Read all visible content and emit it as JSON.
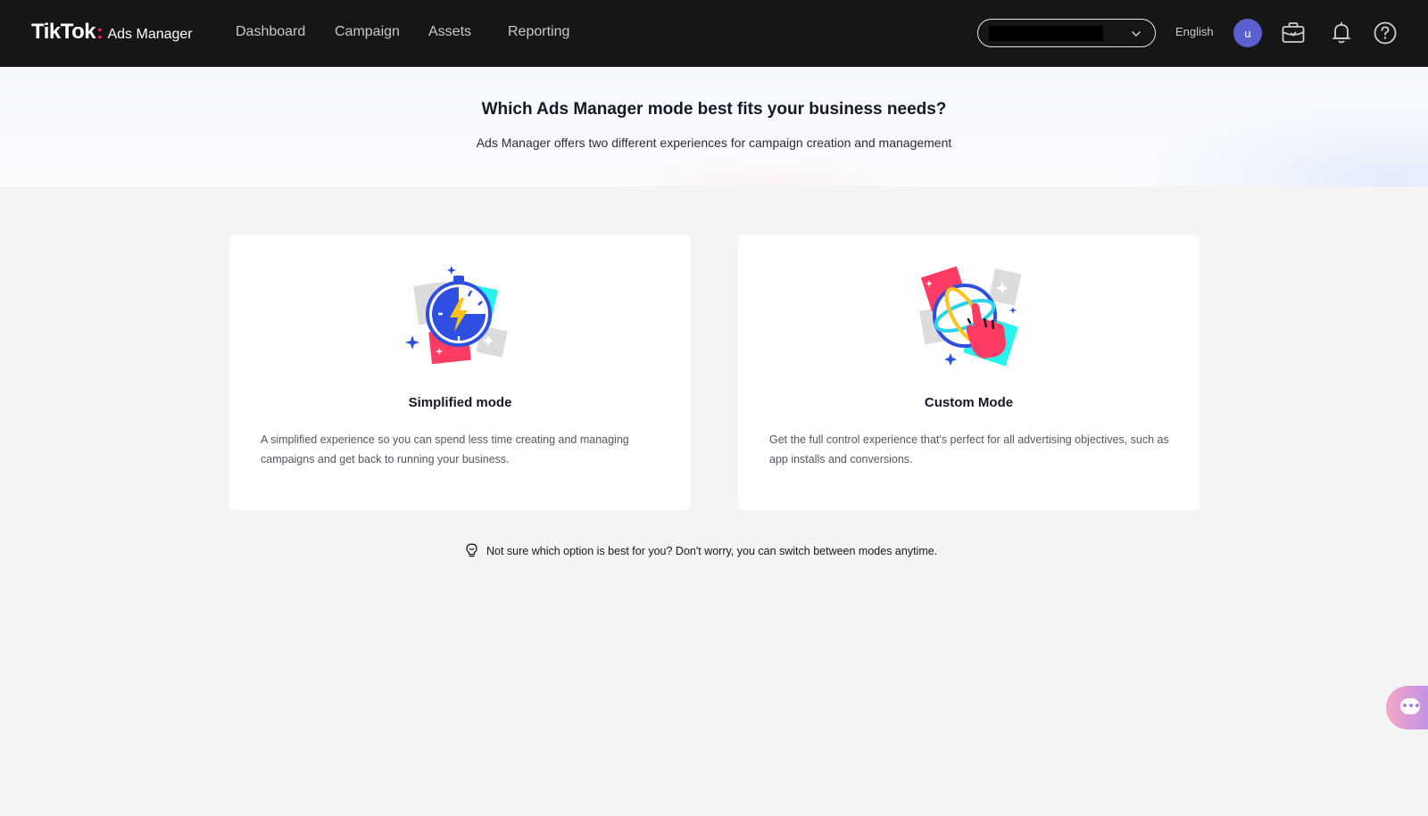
{
  "header": {
    "logo_brand": "TikTok",
    "logo_colon": ":",
    "logo_product": "Ads Manager",
    "nav": [
      {
        "label": "Dashboard"
      },
      {
        "label": "Campaign"
      },
      {
        "label": "Assets"
      },
      {
        "label": "Reporting"
      }
    ],
    "account_select_value": "",
    "language": "English",
    "avatar_letter": "u",
    "icons": [
      "business-center-icon",
      "notification-bell-icon",
      "help-icon"
    ]
  },
  "hero": {
    "title": "Which Ads Manager mode best fits your business needs?",
    "subtitle": "Ads Manager offers two different experiences for campaign creation and management"
  },
  "modes": [
    {
      "title": "Simplified mode",
      "description": "A simplified experience so you can spend less time creating and managing campaigns and get back to running your business.",
      "illustration": "stopwatch-lightning-icon"
    },
    {
      "title": "Custom Mode",
      "description": "Get the full control experience that's perfect for all advertising objectives, such as app installs and conversions.",
      "illustration": "globe-hand-pointer-icon"
    }
  ],
  "tip": {
    "text": "Not sure which option is best for you? Don't worry, you can switch between modes anytime.",
    "icon": "lightbulb-icon"
  },
  "chat": {
    "icon": "chat-bubble-icon"
  },
  "colors": {
    "topbar": "#161616",
    "avatar": "#5b5fd1",
    "tiktok_red": "#fe2c55",
    "tiktok_cyan": "#25f4ee",
    "blue": "#2f4fe0",
    "yellow": "#ffc21a"
  }
}
